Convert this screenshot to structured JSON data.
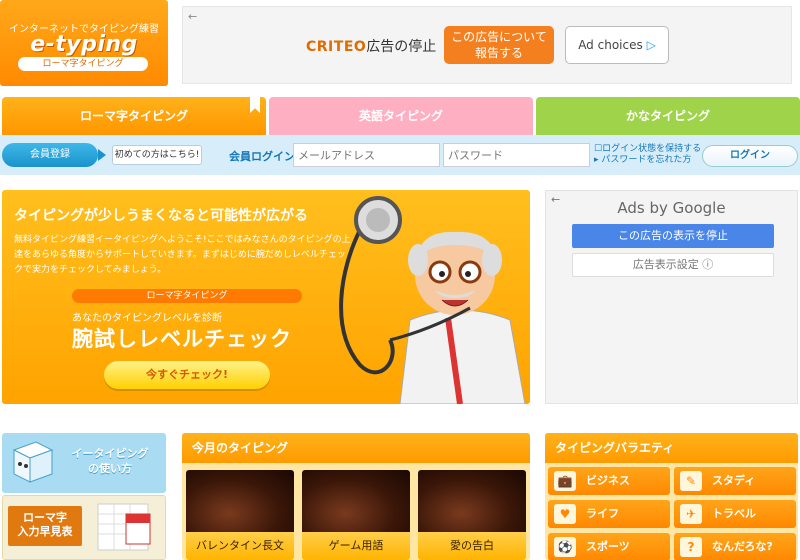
{
  "logo": {
    "tagline": "インターネットでタイピング練習",
    "name": "e-typing",
    "sub": "ローマ字タイピング"
  },
  "ad_top": {
    "back": "←",
    "brand": "CRITEO",
    "stop_text": "広告の停止",
    "report_line1": "この広告について",
    "report_line2": "報告する",
    "choices": "Ad choices",
    "choices_icon": "▷"
  },
  "tabs": [
    {
      "label": "ローマ字タイピング",
      "color": "#ffa000"
    },
    {
      "label": "英語タイピング",
      "color": "#ffafc2"
    },
    {
      "label": "かなタイピング",
      "color": "#9fd44a"
    }
  ],
  "login": {
    "register": "会員登録",
    "first_time": "初めての方はこちら!",
    "label": "会員ログイン",
    "email_placeholder": "メールアドレス",
    "password_placeholder": "パスワード",
    "keep_login": "ログイン状態を保持する",
    "forgot": "パスワードを忘れた方",
    "button": "ログイン"
  },
  "hero": {
    "title": "タイピングが少しうまくなると可能性が広がる",
    "desc": "無料タイピング練習イータイピングへようこそ!ここではみなさんのタイピングの上達をあらゆる角度からサポートしていきます。まずはじめに腕だめしレベルチェックで実力をチェックしてみましょう。",
    "badge": "ローマ字タイピング",
    "sub": "あなたのタイピングレベルを診断",
    "check_title": "腕試しレベルチェック",
    "button": "今すぐチェック!"
  },
  "google_ad": {
    "back": "←",
    "title": "Ads by Google",
    "stop": "この広告の表示を停止",
    "settings": "広告表示設定 ⓘ"
  },
  "side_links": {
    "usage_line1": "イータイピング",
    "usage_line2": "の使い方",
    "chart_line1": "ローマ字",
    "chart_line2": "入力早見表"
  },
  "monthly": {
    "heading": "今月のタイピング",
    "items": [
      {
        "caption": "バレンタイン長文"
      },
      {
        "caption": "ゲーム用語"
      },
      {
        "caption": "愛の告白"
      }
    ]
  },
  "variety": {
    "heading": "タイピングバラエティ",
    "items": [
      {
        "label": "ビジネス",
        "icon": "💼"
      },
      {
        "label": "スタディ",
        "icon": "✎"
      },
      {
        "label": "ライフ",
        "icon": "♥"
      },
      {
        "label": "トラベル",
        "icon": "✈"
      },
      {
        "label": "スポーツ",
        "icon": "⚽"
      },
      {
        "label": "なんだろな?",
        "icon": "?"
      }
    ]
  }
}
